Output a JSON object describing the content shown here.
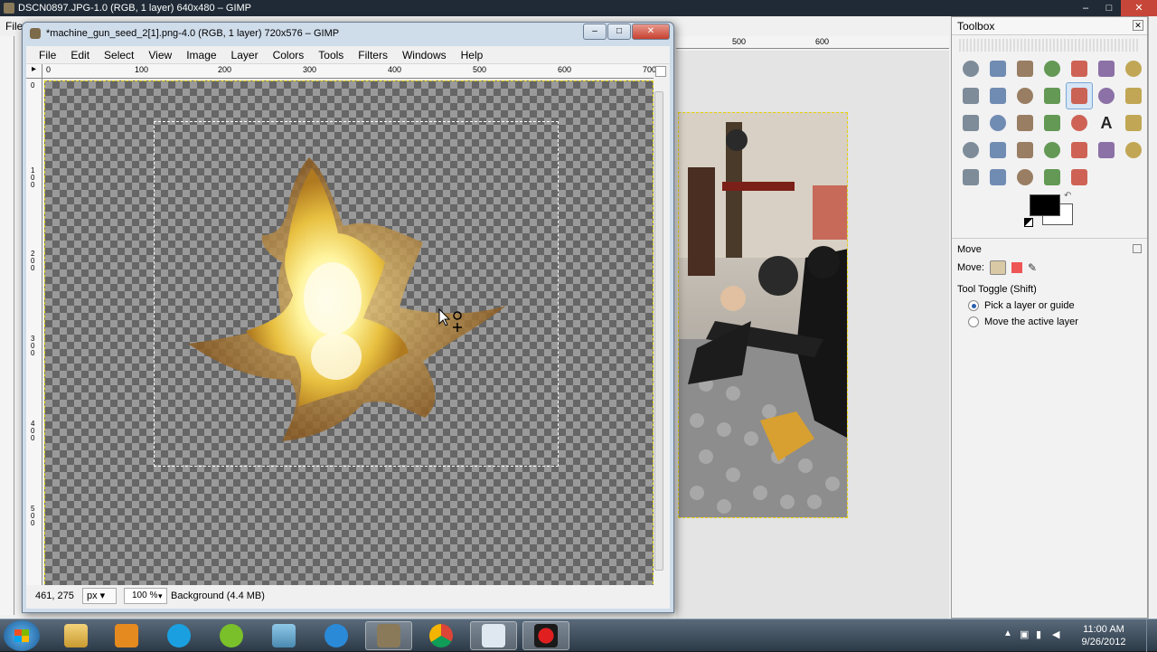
{
  "background_window": {
    "title": "DSCN0897.JPG-1.0 (RGB, 1 layer) 640x480 – GIMP",
    "menu_edge_label": "File",
    "ruler_labels": [
      "500",
      "600"
    ],
    "controls": [
      "–",
      "□",
      "✕"
    ]
  },
  "image_window": {
    "title": "*machine_gun_seed_2[1].png-4.0 (RGB, 1 layer) 720x576 – GIMP",
    "controls": [
      "–",
      "□",
      "✕"
    ],
    "menu": [
      "File",
      "Edit",
      "Select",
      "View",
      "Image",
      "Layer",
      "Colors",
      "Tools",
      "Filters",
      "Windows",
      "Help"
    ],
    "hruler": [
      "0",
      "100",
      "200",
      "300",
      "400",
      "500",
      "600",
      "700"
    ],
    "vruler": [
      "0",
      "100",
      "200",
      "300",
      "400",
      "500"
    ],
    "status": {
      "coords": "461, 275",
      "unit": "px",
      "zoom": "100 %",
      "layer_info": "Background (4.4 MB)"
    }
  },
  "toolbox": {
    "title": "Toolbox",
    "tools": [
      "rect-select",
      "ellipse-select",
      "free-select",
      "fuzzy-select",
      "select-by-color",
      "scissors-select",
      "foreground-select",
      "paths",
      "color-picker",
      "zoom",
      "measure",
      "move",
      "align",
      "crop",
      "rotate",
      "scale",
      "shear",
      "perspective",
      "flip",
      "text",
      "cage-transform",
      "bucket-fill",
      "pencil",
      "paintbrush",
      "eraser",
      "airbrush",
      "ink",
      "clone",
      "heal",
      "perspective-clone",
      "blur-sharpen",
      "smudge",
      "dodge-burn"
    ],
    "active_tool": "move",
    "tool_options": {
      "header": "Move",
      "move_label": "Move:",
      "toggle_label": "Tool Toggle  (Shift)",
      "options": [
        "Pick a layer or guide",
        "Move the active layer"
      ],
      "selected_option": 0
    },
    "colors": {
      "foreground": "#000000",
      "background": "#ffffff"
    }
  },
  "taskbar": {
    "apps": [
      "windows-explorer",
      "media-player",
      "skype",
      "spotify",
      "network-app",
      "internet-explorer",
      "gimp",
      "chrome",
      "dvd-maker",
      "recorder"
    ],
    "active_app": "gimp",
    "clock_time": "11:00 AM",
    "clock_date": "9/26/2012"
  }
}
